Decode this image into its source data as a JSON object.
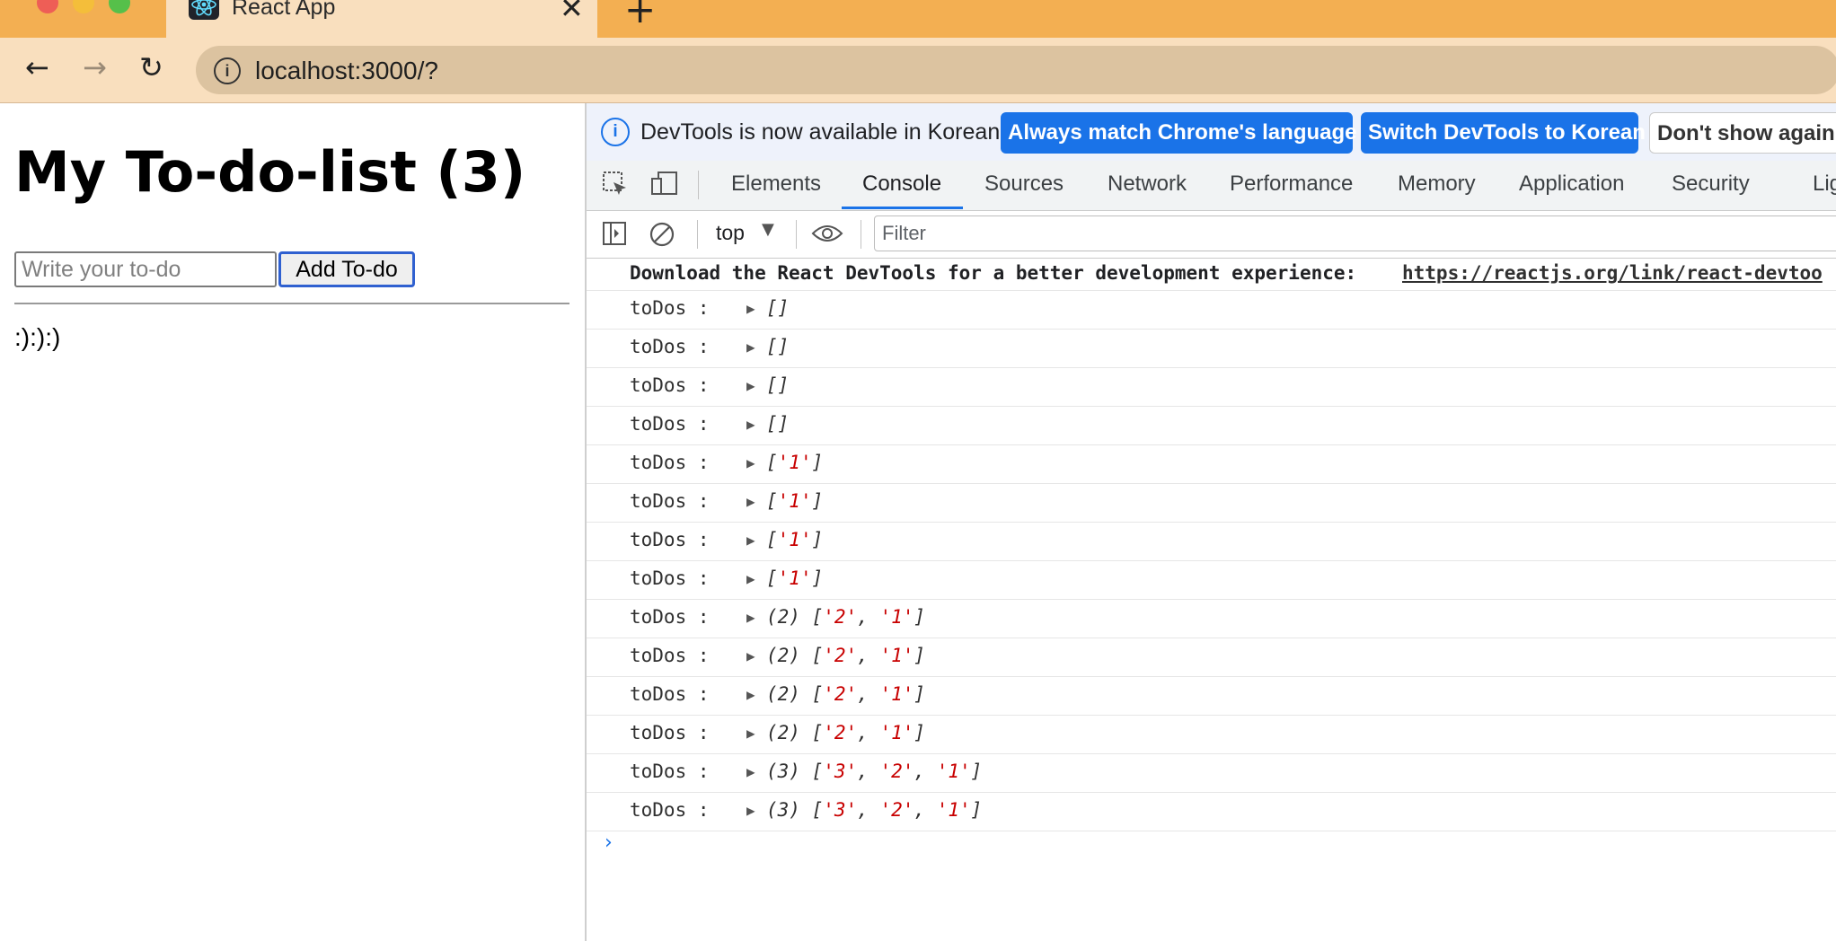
{
  "browser": {
    "tab_title": "React App",
    "tab_close": "✕",
    "new_tab": "+",
    "url": "localhost:3000/?",
    "back": "←",
    "forward": "→",
    "reload": "↻"
  },
  "page": {
    "heading": "My To-do-list (3)",
    "input_placeholder": "Write your to-do",
    "add_button": "Add To-do",
    "content_text": ":):):)"
  },
  "devtools": {
    "info_text": "DevTools is now available in Korean!",
    "btn_match": "Always match Chrome's language",
    "btn_switch": "Switch DevTools to Korean",
    "btn_dont_show": "Don't show again",
    "tabs": [
      "Elements",
      "Console",
      "Sources",
      "Network",
      "Performance",
      "Memory",
      "Application",
      "Security",
      "Lig"
    ],
    "active_tab": "Console",
    "context": "top",
    "filter_placeholder": "Filter",
    "console_download_text": "Download the React DevTools for a better development experience: ",
    "console_download_link": "https://reactjs.org/link/react-devtoo",
    "log_label": "toDos :",
    "logs": [
      {
        "count": "",
        "items": []
      },
      {
        "count": "",
        "items": []
      },
      {
        "count": "",
        "items": []
      },
      {
        "count": "",
        "items": []
      },
      {
        "count": "",
        "items": [
          "'1'"
        ]
      },
      {
        "count": "",
        "items": [
          "'1'"
        ]
      },
      {
        "count": "",
        "items": [
          "'1'"
        ]
      },
      {
        "count": "",
        "items": [
          "'1'"
        ]
      },
      {
        "count": "(2) ",
        "items": [
          "'2'",
          "'1'"
        ]
      },
      {
        "count": "(2) ",
        "items": [
          "'2'",
          "'1'"
        ]
      },
      {
        "count": "(2) ",
        "items": [
          "'2'",
          "'1'"
        ]
      },
      {
        "count": "(2) ",
        "items": [
          "'2'",
          "'1'"
        ]
      },
      {
        "count": "(3) ",
        "items": [
          "'3'",
          "'2'",
          "'1'"
        ]
      },
      {
        "count": "(3) ",
        "items": [
          "'3'",
          "'2'",
          "'1'"
        ]
      }
    ],
    "prompt": "›"
  },
  "colors": {
    "tabbar": "#f3af52",
    "toolbar": "#f9dfbe",
    "accent": "#1a73e8",
    "string": "#c80000"
  }
}
